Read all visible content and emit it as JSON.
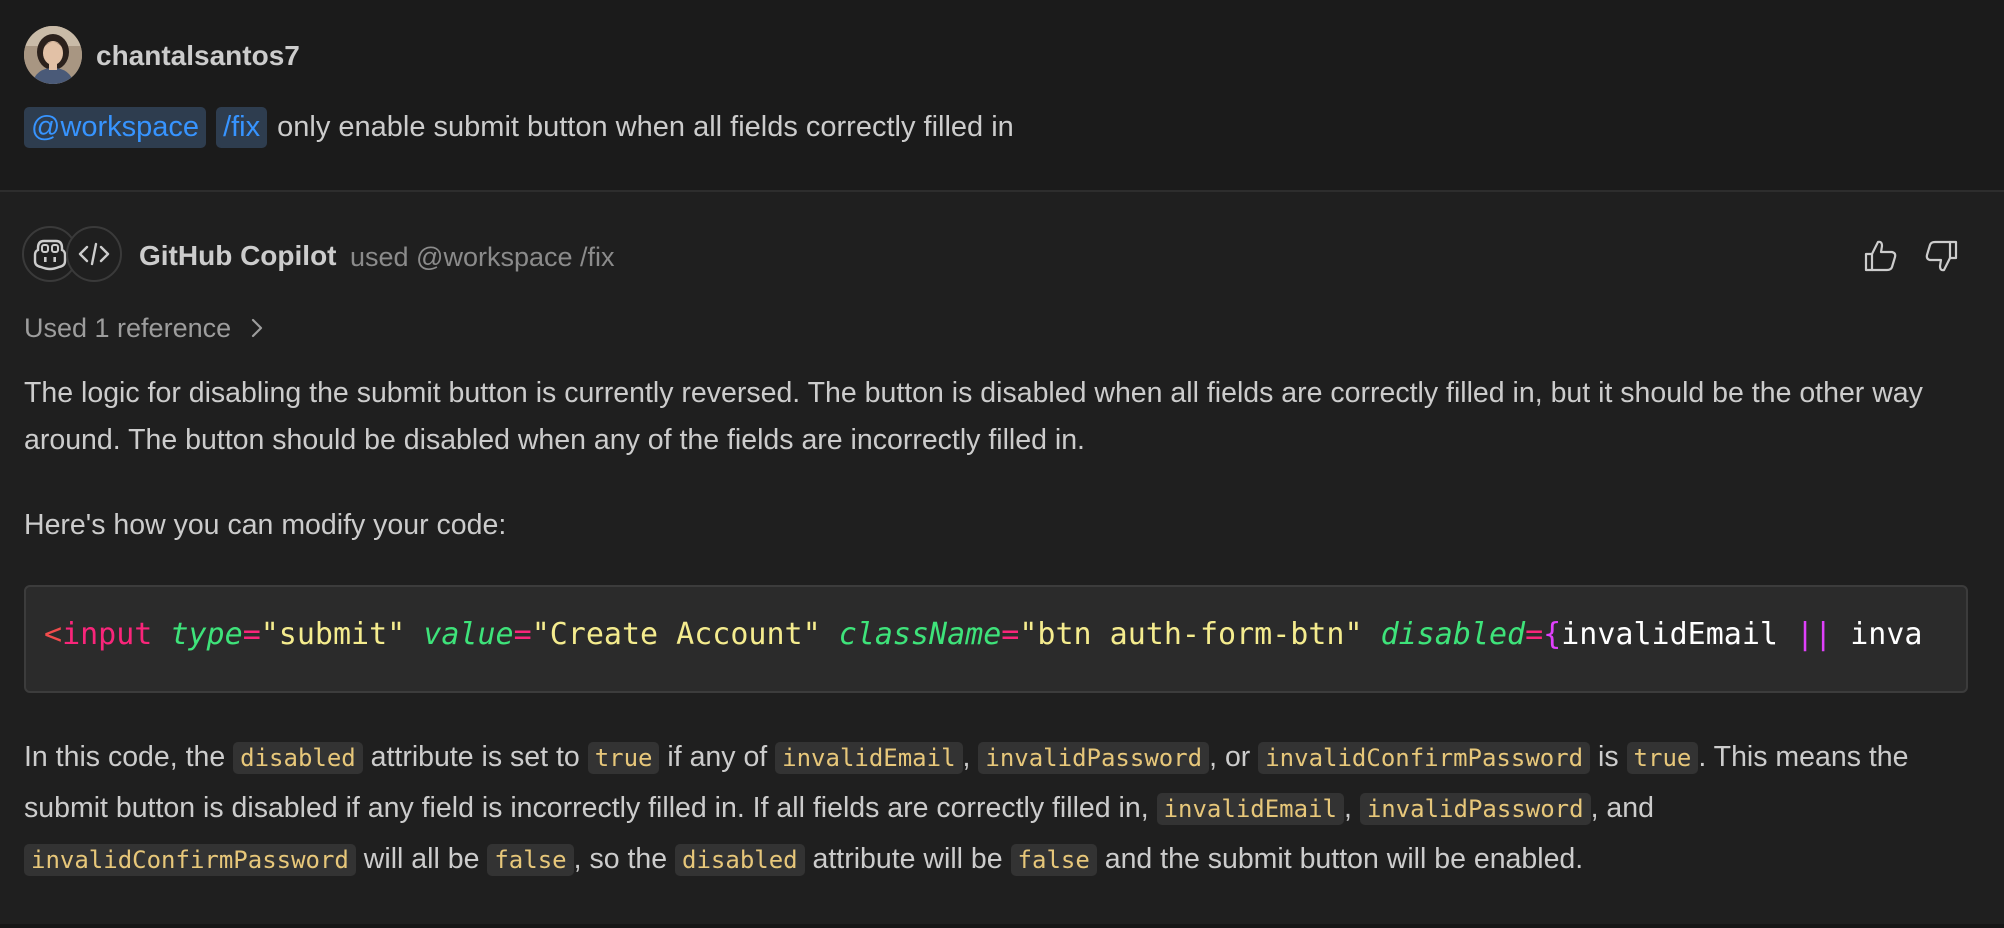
{
  "user": {
    "username": "chantalsantos7",
    "mentions": [
      "@workspace",
      "/fix"
    ],
    "prompt": "only enable submit button when all fields correctly filled in"
  },
  "assistant": {
    "name": "GitHub Copilot",
    "meta": "used @workspace /fix",
    "references_label": "Used 1 reference",
    "paragraph1": "The logic for disabling the submit button is currently reversed. The button is disabled when all fields are correctly filled in, but it should be the other way around. The button should be disabled when any of the fields are incorrectly filled in.",
    "paragraph2": "Here's how you can modify your code:",
    "code": {
      "open_bracket": "<",
      "tag": "input",
      "attr_type": "type",
      "eq": "=",
      "val_type": "\"submit\"",
      "attr_value": "value",
      "val_value": "\"Create Account\"",
      "attr_class": "className",
      "val_class": "\"btn auth-form-btn\"",
      "attr_disabled": "disabled",
      "brace_open": "{",
      "id1": "invalidEmail",
      "or": "||",
      "id2": "inva"
    },
    "explanation": {
      "t1": "In this code, the ",
      "c1": "disabled",
      "t2": " attribute is set to ",
      "c2": "true",
      "t3": " if any of ",
      "c3": "invalidEmail",
      "t4": ", ",
      "c4": "invalidPassword",
      "t5": ", or ",
      "c5": "invalidConfirmPassword",
      "t6": " is ",
      "c6": "true",
      "t7": ". This means the submit button is disabled if any field is incorrectly filled in. If all fields are correctly filled in, ",
      "c7": "invalidEmail",
      "t8": ", ",
      "c8": "invalidPassword",
      "t9": ", and ",
      "c9": "invalidConfirmPassword",
      "t10": " will all be ",
      "c10": "false",
      "t11": ", so the ",
      "c11": "disabled",
      "t12": " attribute will be ",
      "c12": "false",
      "t13": " and the submit button will be enabled."
    }
  },
  "icons": {
    "avatar": "user-avatar",
    "copilot": "copilot-icon",
    "code": "code-icon",
    "thumbs_up": "thumbs-up-icon",
    "thumbs_down": "thumbs-down-icon",
    "chevron": "chevron-right-icon"
  },
  "colors": {
    "accent_chip_bg": "#2e3d4f",
    "accent_chip_text": "#3794ff",
    "inline_code_text": "#e7c77a"
  }
}
